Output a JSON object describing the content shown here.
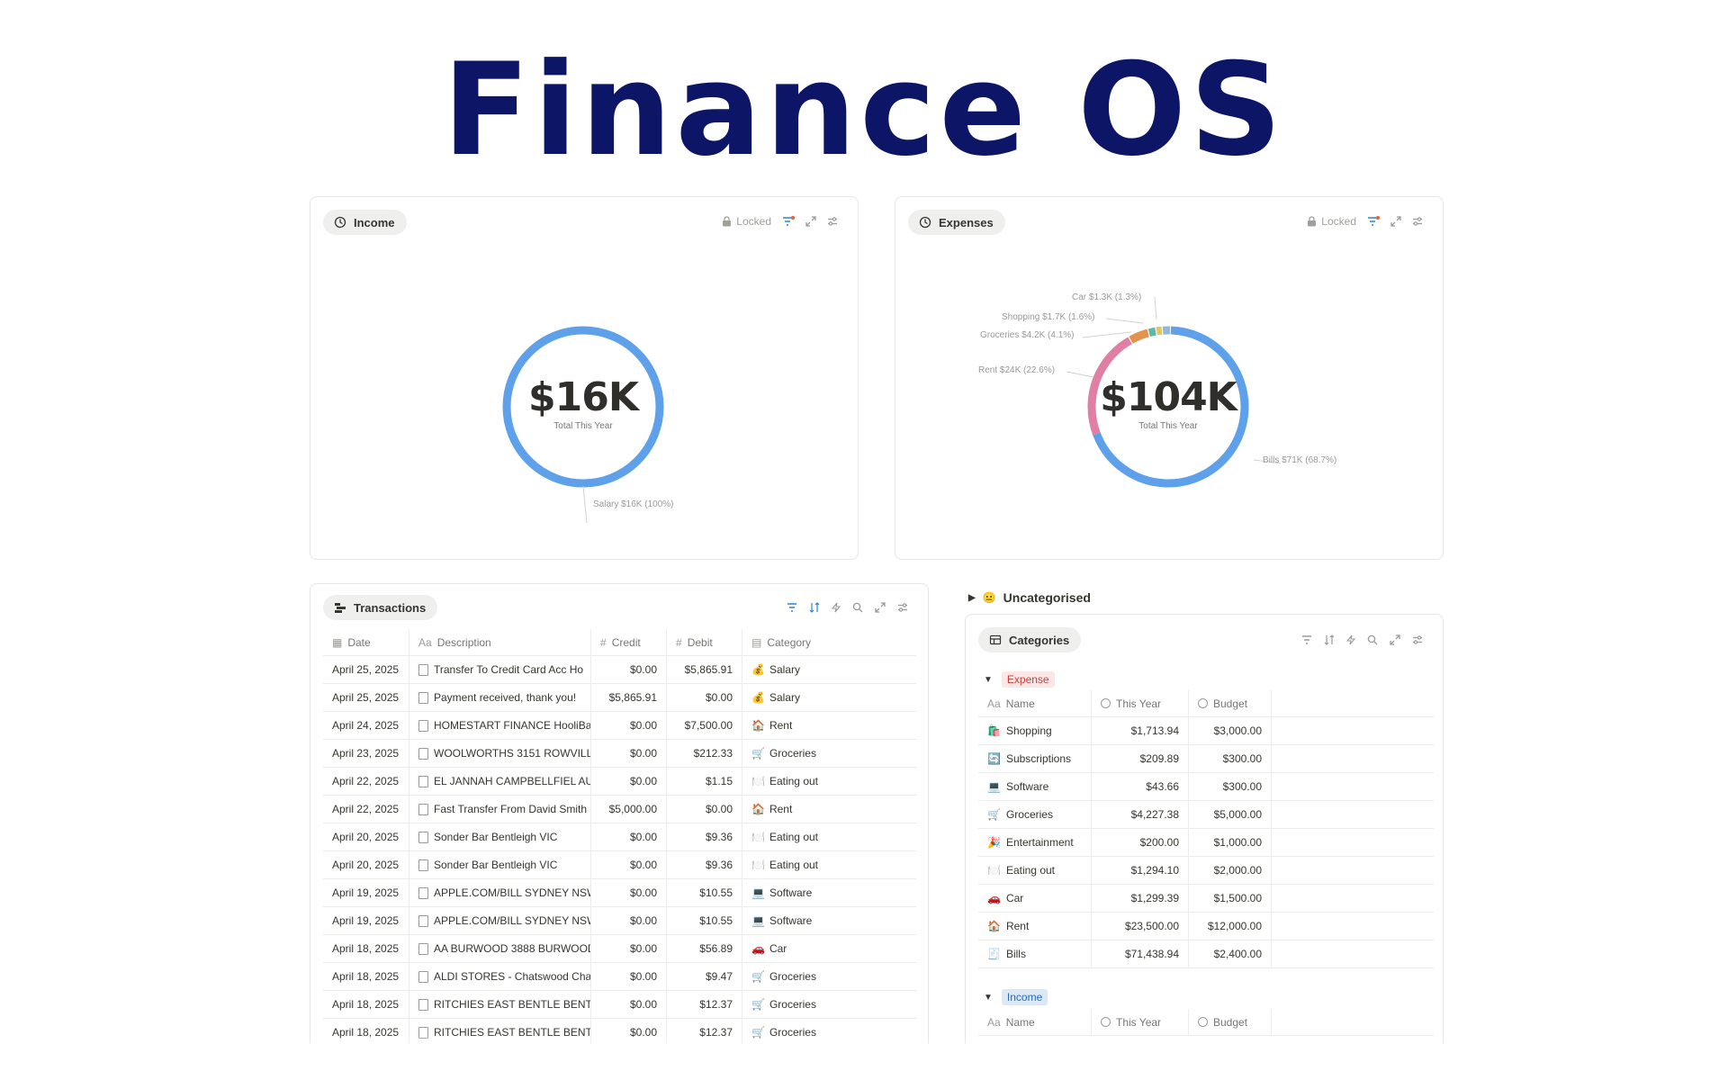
{
  "page": {
    "title": "Finance OS"
  },
  "income": {
    "label": "Income",
    "locked_label": "Locked",
    "total": "$16K",
    "subtitle": "Total This Year",
    "callouts": [
      "Salary  $16K (100%)"
    ],
    "colors": {
      "ring": "#5ea1ea"
    }
  },
  "expenses": {
    "label": "Expenses",
    "locked_label": "Locked",
    "total": "$104K",
    "subtitle": "Total This Year",
    "callouts": {
      "car": "Car  $1.3K (1.3%)",
      "shopping": "Shopping  $1.7K (1.6%)",
      "groceries": "Groceries  $4.2K (4.1%)",
      "rent": "Rent  $24K (22.6%)",
      "bills": "Bills  $71K (68.7%)"
    },
    "slices": [
      {
        "name": "Bills",
        "pct": 68.7,
        "color": "#5ea1ea"
      },
      {
        "name": "Rent",
        "pct": 22.6,
        "color": "#e07fa3"
      },
      {
        "name": "Groceries",
        "pct": 4.1,
        "color": "#e3934d"
      },
      {
        "name": "Shopping",
        "pct": 1.6,
        "color": "#5fb8a6"
      },
      {
        "name": "Car",
        "pct": 1.3,
        "color": "#e8c55a"
      },
      {
        "name": "Other",
        "pct": 1.7,
        "color": "#8fb8e0"
      }
    ]
  },
  "transactions": {
    "label": "Transactions",
    "columns": {
      "date": "Date",
      "description": "Description",
      "credit": "Credit",
      "debit": "Debit",
      "category": "Category"
    },
    "rows": [
      {
        "date": "April 25, 2025",
        "description": "Transfer To Credit Card Acc Ho",
        "credit": "$0.00",
        "debit": "$5,865.91",
        "icon": "💰",
        "category": "Salary"
      },
      {
        "date": "April 25, 2025",
        "description": "Payment received, thank you!",
        "credit": "$5,865.91",
        "debit": "$0.00",
        "icon": "💰",
        "category": "Salary"
      },
      {
        "date": "April 24, 2025",
        "description": "HOMESTART FINANCE HooliBa",
        "credit": "$0.00",
        "debit": "$7,500.00",
        "icon": "🏠",
        "category": "Rent"
      },
      {
        "date": "April 23, 2025",
        "description": "WOOLWORTHS 3151 ROWVILL",
        "credit": "$0.00",
        "debit": "$212.33",
        "icon": "🛒",
        "category": "Groceries"
      },
      {
        "date": "April 22, 2025",
        "description": "EL JANNAH CAMPBELLFIEL AU",
        "credit": "$0.00",
        "debit": "$1.15",
        "icon": "🍽️",
        "category": "Eating out"
      },
      {
        "date": "April 22, 2025",
        "description": "Fast Transfer From David Smith",
        "credit": "$5,000.00",
        "debit": "$0.00",
        "icon": "🏠",
        "category": "Rent"
      },
      {
        "date": "April 20, 2025",
        "description": "Sonder Bar Bentleigh VIC",
        "credit": "$0.00",
        "debit": "$9.36",
        "icon": "🍽️",
        "category": "Eating out"
      },
      {
        "date": "April 20, 2025",
        "description": "Sonder Bar Bentleigh VIC",
        "credit": "$0.00",
        "debit": "$9.36",
        "icon": "🍽️",
        "category": "Eating out"
      },
      {
        "date": "April 19, 2025",
        "description": "APPLE.COM/BILL SYDNEY NSW",
        "credit": "$0.00",
        "debit": "$10.55",
        "icon": "💻",
        "category": "Software"
      },
      {
        "date": "April 19, 2025",
        "description": "APPLE.COM/BILL SYDNEY NSW",
        "credit": "$0.00",
        "debit": "$10.55",
        "icon": "💻",
        "category": "Software"
      },
      {
        "date": "April 18, 2025",
        "description": "AA BURWOOD 3888 BURWOOD",
        "credit": "$0.00",
        "debit": "$56.89",
        "icon": "🚗",
        "category": "Car"
      },
      {
        "date": "April 18, 2025",
        "description": "ALDI STORES - Chatswood Cha",
        "credit": "$0.00",
        "debit": "$9.47",
        "icon": "🛒",
        "category": "Groceries"
      },
      {
        "date": "April 18, 2025",
        "description": "RITCHIES EAST BENTLE BENTL",
        "credit": "$0.00",
        "debit": "$12.37",
        "icon": "🛒",
        "category": "Groceries"
      },
      {
        "date": "April 18, 2025",
        "description": "RITCHIES EAST BENTLE BENTL",
        "credit": "$0.00",
        "debit": "$12.37",
        "icon": "🛒",
        "category": "Groceries"
      }
    ]
  },
  "uncategorised": {
    "icon": "😐",
    "label": "Uncategorised"
  },
  "categories": {
    "label": "Categories",
    "columns": {
      "name": "Name",
      "this_year": "This Year",
      "budget": "Budget"
    },
    "expense_group": {
      "label": "Expense",
      "rows": [
        {
          "icon": "🛍️",
          "name": "Shopping",
          "this_year": "$1,713.94",
          "budget": "$3,000.00"
        },
        {
          "icon": "🔄",
          "name": "Subscriptions",
          "this_year": "$209.89",
          "budget": "$300.00"
        },
        {
          "icon": "💻",
          "name": "Software",
          "this_year": "$43.66",
          "budget": "$300.00"
        },
        {
          "icon": "🛒",
          "name": "Groceries",
          "this_year": "$4,227.38",
          "budget": "$5,000.00"
        },
        {
          "icon": "🎉",
          "name": "Entertainment",
          "this_year": "$200.00",
          "budget": "$1,000.00"
        },
        {
          "icon": "🍽️",
          "name": "Eating out",
          "this_year": "$1,294.10",
          "budget": "$2,000.00"
        },
        {
          "icon": "🚗",
          "name": "Car",
          "this_year": "$1,299.39",
          "budget": "$1,500.00"
        },
        {
          "icon": "🏠",
          "name": "Rent",
          "this_year": "$23,500.00",
          "budget": "$12,000.00"
        },
        {
          "icon": "🧾",
          "name": "Bills",
          "this_year": "$71,438.94",
          "budget": "$2,400.00"
        }
      ]
    },
    "income_group": {
      "label": "Income"
    }
  }
}
